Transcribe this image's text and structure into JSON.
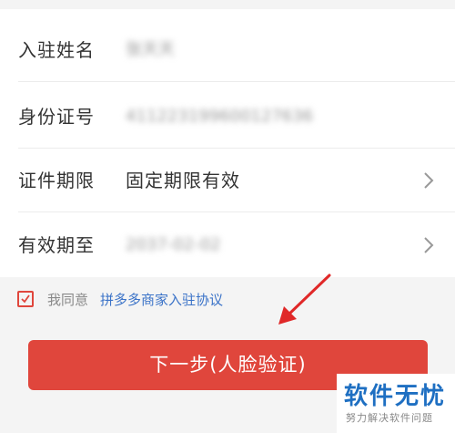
{
  "form": {
    "rows": [
      {
        "label": "入驻姓名",
        "value": "张天天"
      },
      {
        "label": "身份证号",
        "value": "411223199600127636"
      },
      {
        "label": "证件期限",
        "value": "固定期限有效"
      },
      {
        "label": "有效期至",
        "value": "2037-02-02"
      }
    ]
  },
  "agreement": {
    "checked": true,
    "prefix": "我同意",
    "link_text": "拼多多商家入驻协议"
  },
  "next_button": {
    "label": "下一步(人脸验证)"
  },
  "watermark": {
    "main": "软件无忧",
    "sub": "努力解决软件问题"
  },
  "colors": {
    "accent": "#e0463c",
    "link": "#3b73c8",
    "watermark": "#1e6fc2"
  }
}
